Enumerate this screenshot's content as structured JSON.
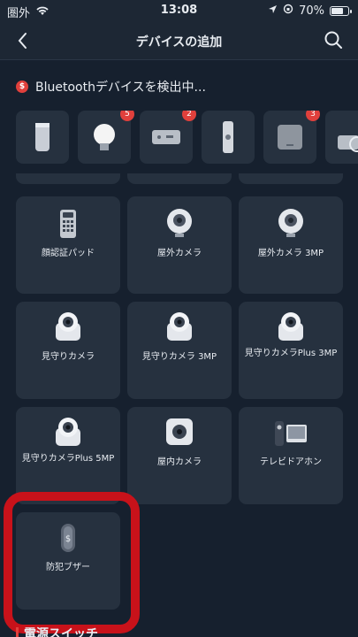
{
  "status": {
    "carrier": "圏外",
    "time": "13:08",
    "battery": "70%"
  },
  "nav": {
    "title": "デバイスの追加"
  },
  "scan": {
    "text": "Bluetoothデバイスを検出中...",
    "badge_icon": "dollar-icon",
    "devices": [
      {
        "icon": "speaker-icon",
        "badge": ""
      },
      {
        "icon": "bulb-icon",
        "badge": "5"
      },
      {
        "icon": "hub-icon",
        "badge": "2"
      },
      {
        "icon": "remote-icon",
        "badge": ""
      },
      {
        "icon": "sensor-icon",
        "badge": "3"
      },
      {
        "icon": "bot-icon",
        "badge": ""
      }
    ]
  },
  "devices": [
    {
      "label": "顔認証パッド",
      "icon": "keypad-icon"
    },
    {
      "label": "屋外カメラ",
      "icon": "camera-icon"
    },
    {
      "label": "屋外カメラ 3MP",
      "icon": "camera-icon"
    },
    {
      "label": "見守りカメラ",
      "icon": "dome-camera-icon"
    },
    {
      "label": "見守りカメラ 3MP",
      "icon": "dome-camera-icon"
    },
    {
      "label": "見守りカメラPlus 3MP",
      "icon": "dome-camera-icon"
    },
    {
      "label": "見守りカメラPlus 5MP",
      "icon": "dome-camera-icon"
    },
    {
      "label": "屋内カメラ",
      "icon": "indoor-camera-icon"
    },
    {
      "label": "テレビドアホン",
      "icon": "doorbell-icon"
    },
    {
      "label": "防犯ブザー",
      "icon": "alarm-buzzer-icon"
    }
  ],
  "section": {
    "label": "電源スイッチ"
  },
  "colors": {
    "background": "#16202e",
    "card": "#26313f",
    "accent": "#e0403c",
    "highlight": "#c8121a"
  }
}
